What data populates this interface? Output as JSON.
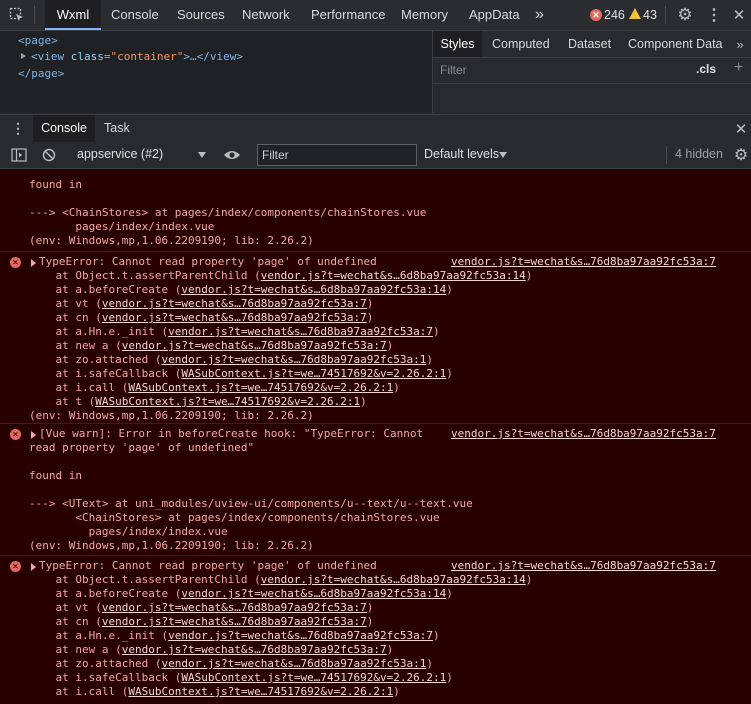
{
  "topbar": {
    "tabs": [
      "Wxml",
      "Console",
      "Sources",
      "Network",
      "Performance",
      "Memory",
      "AppData"
    ],
    "more": "»",
    "error_count": "246",
    "warning_count": "43"
  },
  "elements": {
    "line1": "<page>",
    "line2_tag": "<view",
    "line2_attr": "class",
    "line2_val": "\"container\"",
    "line2_rest": ">…</view>",
    "line3": "</page>"
  },
  "styles": {
    "tabs": [
      "Styles",
      "Computed",
      "Dataset",
      "Component Data"
    ],
    "filter_placeholder": "Filter",
    "cls": ".cls",
    "plus": "+"
  },
  "drawer": {
    "tabs": [
      "Console",
      "Task"
    ]
  },
  "toolbar": {
    "context": "appservice (#2)",
    "filter_placeholder": "Filter",
    "levels": "Default levels",
    "hidden": "4 hidden"
  },
  "console": {
    "m0": {
      "l1": "found in",
      "l2a": "---> <ChainStores> at pages/index/components/chainStores.vue",
      "l2b": "       pages/index/index.vue",
      "l3": "(env: Windows,mp,1.06.2209190; lib: 2.26.2)"
    },
    "m1": {
      "head": "TypeError: Cannot read property 'page' of undefined",
      "src": "vendor.js?t=wechat&s…76d8ba97aa92fc53a:7",
      "stack": [
        {
          "fn": "    at Object.t.assertParentChild (",
          "link": "vendor.js?t=wechat&s…6d8ba97aa92fc53a:14",
          "end": ")"
        },
        {
          "fn": "    at a.beforeCreate (",
          "link": "vendor.js?t=wechat&s…6d8ba97aa92fc53a:14",
          "end": ")"
        },
        {
          "fn": "    at vt (",
          "link": "vendor.js?t=wechat&s…76d8ba97aa92fc53a:7",
          "end": ")"
        },
        {
          "fn": "    at cn (",
          "link": "vendor.js?t=wechat&s…76d8ba97aa92fc53a:7",
          "end": ")"
        },
        {
          "fn": "    at a.Hn.e._init (",
          "link": "vendor.js?t=wechat&s…76d8ba97aa92fc53a:7",
          "end": ")"
        },
        {
          "fn": "    at new a (",
          "link": "vendor.js?t=wechat&s…76d8ba97aa92fc53a:7",
          "end": ")"
        },
        {
          "fn": "    at zo.attached (",
          "link": "vendor.js?t=wechat&s…76d8ba97aa92fc53a:1",
          "end": ")"
        },
        {
          "fn": "    at i.safeCallback (",
          "link": "WASubContext.js?t=we…74517692&v=2.26.2:1",
          "end": ")"
        },
        {
          "fn": "    at i.call (",
          "link": "WASubContext.js?t=we…74517692&v=2.26.2:1",
          "end": ")"
        },
        {
          "fn": "    at t (",
          "link": "WASubContext.js?t=we…74517692&v=2.26.2:1",
          "end": ")"
        }
      ],
      "env": "(env: Windows,mp,1.06.2209190; lib: 2.26.2)"
    },
    "m2": {
      "head1": "[Vue warn]: Error in beforeCreate hook: \"TypeError: Cannot",
      "head2": "read property 'page' of undefined\"",
      "src": "vendor.js?t=wechat&s…76d8ba97aa92fc53a:7",
      "found": "found in",
      "t1": "---> <UText> at uni_modules/uview-ui/components/u--text/u--text.vue",
      "t2": "       <ChainStores> at pages/index/components/chainStores.vue",
      "t3": "         pages/index/index.vue",
      "env": "(env: Windows,mp,1.06.2209190; lib: 2.26.2)"
    },
    "m3": {
      "head": "TypeError: Cannot read property 'page' of undefined",
      "src": "vendor.js?t=wechat&s…76d8ba97aa92fc53a:7",
      "stack": [
        {
          "fn": "    at Object.t.assertParentChild (",
          "link": "vendor.js?t=wechat&s…6d8ba97aa92fc53a:14",
          "end": ")"
        },
        {
          "fn": "    at a.beforeCreate (",
          "link": "vendor.js?t=wechat&s…6d8ba97aa92fc53a:14",
          "end": ")"
        },
        {
          "fn": "    at vt (",
          "link": "vendor.js?t=wechat&s…76d8ba97aa92fc53a:7",
          "end": ")"
        },
        {
          "fn": "    at cn (",
          "link": "vendor.js?t=wechat&s…76d8ba97aa92fc53a:7",
          "end": ")"
        },
        {
          "fn": "    at a.Hn.e._init (",
          "link": "vendor.js?t=wechat&s…76d8ba97aa92fc53a:7",
          "end": ")"
        },
        {
          "fn": "    at new a (",
          "link": "vendor.js?t=wechat&s…76d8ba97aa92fc53a:7",
          "end": ")"
        },
        {
          "fn": "    at zo.attached (",
          "link": "vendor.js?t=wechat&s…76d8ba97aa92fc53a:1",
          "end": ")"
        },
        {
          "fn": "    at i.safeCallback (",
          "link": "WASubContext.js?t=we…74517692&v=2.26.2:1",
          "end": ")"
        },
        {
          "fn": "    at i.call (",
          "link": "WASubContext.js?t=we…74517692&v=2.26.2:1",
          "end": ")"
        }
      ]
    }
  }
}
